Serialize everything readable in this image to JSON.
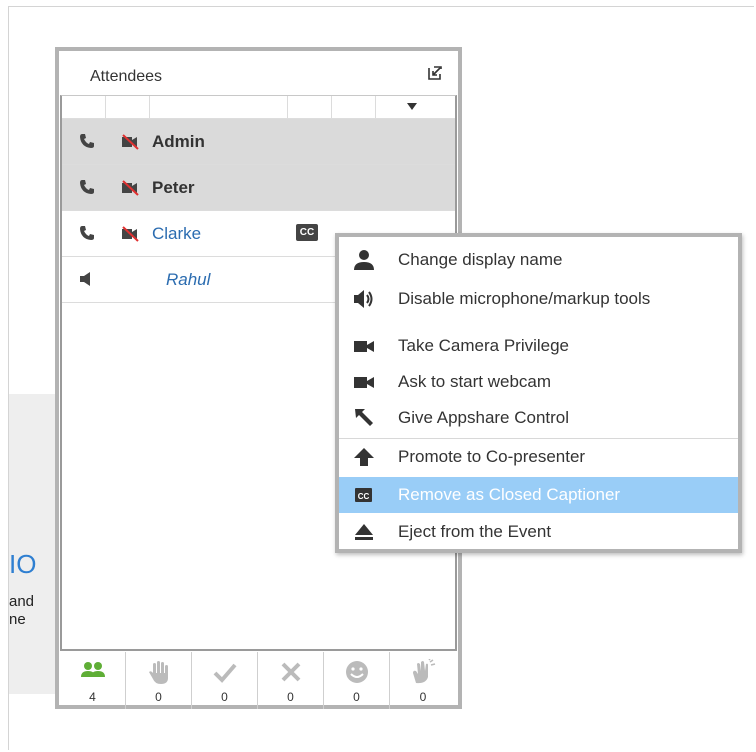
{
  "background": {
    "heading_fragment": "IO",
    "line1": "and",
    "line2": "ne"
  },
  "attendees": {
    "title": "Attendees",
    "rows": [
      {
        "name": "Admin",
        "selected": true
      },
      {
        "name": "Peter",
        "selected": true
      },
      {
        "name": "Clarke",
        "selected": false,
        "badge": "CC"
      },
      {
        "name": "Rahul",
        "selected": false
      }
    ],
    "footer": [
      {
        "icon": "users-icon",
        "count": "4",
        "color": "#5fae36"
      },
      {
        "icon": "raise-hand-icon",
        "count": "0"
      },
      {
        "icon": "checkmark-icon",
        "count": "0"
      },
      {
        "icon": "cross-icon",
        "count": "0"
      },
      {
        "icon": "smiley-icon",
        "count": "0"
      },
      {
        "icon": "applause-icon",
        "count": "0"
      }
    ]
  },
  "context_menu": {
    "items": [
      {
        "label": "Change display name",
        "icon": "person-icon"
      },
      {
        "label": "Disable microphone/markup tools",
        "icon": "speaker-icon"
      },
      {
        "label": "Take Camera Privilege",
        "icon": "camera-icon"
      },
      {
        "label": "Ask to start webcam",
        "icon": "camera-icon"
      },
      {
        "label": "Give Appshare Control",
        "icon": "cursor-arrow-icon"
      },
      {
        "label": "Promote to Co-presenter",
        "icon": "arrow-up-icon"
      },
      {
        "label": "Remove as Closed Captioner",
        "icon": "closed-caption-icon",
        "highlighted": true
      },
      {
        "label": "Eject from the Event",
        "icon": "eject-icon"
      }
    ]
  },
  "colors": {
    "highlight": "#99cdf7",
    "name_link": "#2b6cb0",
    "users_green": "#5fae36"
  }
}
